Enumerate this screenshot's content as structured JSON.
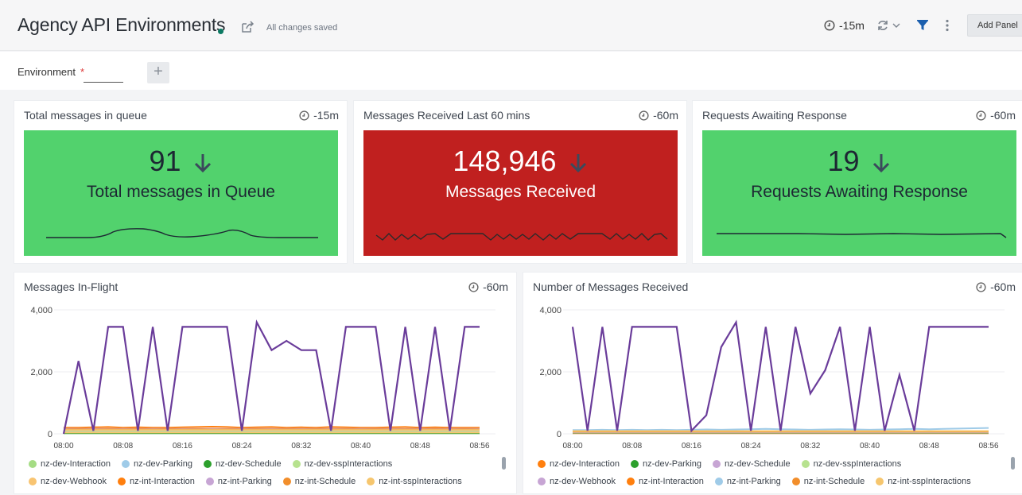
{
  "header": {
    "title": "Agency API Environments",
    "saved_status": "All changes saved",
    "time_range": "-15m",
    "add_panel_label": "Add Panel"
  },
  "variables": {
    "environment_label": "Environment",
    "required_marker": "*",
    "environment_value": "",
    "add_symbol": "+"
  },
  "panels": [
    {
      "title": "Total messages in queue",
      "time": "-15m",
      "value": "91",
      "label": "Total messages in Queue",
      "color": "#52d26d"
    },
    {
      "title": "Messages Received Last  60 mins",
      "time": "-60m",
      "value": "148,946",
      "label": "Messages Received",
      "color": "#c0201f"
    },
    {
      "title": "Requests Awaiting Response",
      "time": "-60m",
      "value": "19",
      "label": "Requests Awaiting Response",
      "color": "#52d26d"
    }
  ],
  "charts": {
    "inflight": {
      "title": "Messages In-Flight",
      "time": "-60m"
    },
    "received": {
      "title": "Number of Messages Received",
      "time": "-60m"
    }
  },
  "chart_data": [
    {
      "type": "line",
      "title": "Messages In-Flight",
      "xlabel": "",
      "ylabel": "",
      "x": [
        "08:00",
        "08:02",
        "08:04",
        "08:06",
        "08:08",
        "08:10",
        "08:12",
        "08:14",
        "08:16",
        "08:18",
        "08:20",
        "08:22",
        "08:24",
        "08:26",
        "08:28",
        "08:30",
        "08:32",
        "08:34",
        "08:36",
        "08:38",
        "08:40",
        "08:42",
        "08:44",
        "08:46",
        "08:48",
        "08:50",
        "08:52",
        "08:54",
        "08:56"
      ],
      "x_ticks": [
        "08:00",
        "08:08",
        "08:16",
        "08:24",
        "08:32",
        "08:40",
        "08:48",
        "08:56"
      ],
      "y_ticks": [
        "0",
        "2,000",
        "4,000"
      ],
      "ylim": [
        0,
        4000
      ],
      "grid": true,
      "legend": "bottom",
      "series": [
        {
          "name": "nz-dev-Interaction",
          "color": "#a5dc84",
          "values": [
            100,
            100,
            100,
            100,
            100,
            100,
            100,
            100,
            100,
            100,
            100,
            100,
            100,
            100,
            100,
            100,
            100,
            100,
            100,
            100,
            100,
            100,
            100,
            100,
            100,
            100,
            100,
            100,
            100
          ]
        },
        {
          "name": "nz-dev-Parking",
          "color": "#9fcbe8",
          "values": [
            80,
            80,
            80,
            80,
            80,
            80,
            80,
            80,
            80,
            80,
            80,
            80,
            80,
            80,
            80,
            80,
            80,
            80,
            80,
            80,
            80,
            80,
            80,
            80,
            80,
            80,
            80,
            80,
            80
          ]
        },
        {
          "name": "nz-dev-Schedule",
          "color": "#2ca02c",
          "values": [
            20,
            20,
            20,
            20,
            20,
            20,
            20,
            20,
            20,
            20,
            20,
            20,
            20,
            20,
            20,
            20,
            20,
            20,
            20,
            20,
            20,
            20,
            20,
            20,
            20,
            20,
            20,
            20,
            20
          ]
        },
        {
          "name": "nz-dev-sspInteractions",
          "color": "#b7e28f",
          "values": [
            60,
            60,
            60,
            60,
            60,
            60,
            60,
            60,
            60,
            60,
            60,
            60,
            60,
            60,
            60,
            60,
            60,
            60,
            60,
            60,
            60,
            60,
            60,
            60,
            60,
            60,
            60,
            60,
            60
          ]
        },
        {
          "name": "nz-dev-Webhook",
          "color": "#f8c471",
          "values": [
            40,
            40,
            40,
            40,
            40,
            40,
            40,
            40,
            40,
            40,
            40,
            40,
            40,
            40,
            40,
            40,
            40,
            40,
            40,
            40,
            40,
            40,
            40,
            40,
            40,
            40,
            40,
            40,
            40
          ]
        },
        {
          "name": "nz-int-Interaction",
          "color": "#ff7f0e",
          "values": [
            200,
            200,
            210,
            220,
            200,
            210,
            200,
            200,
            210,
            220,
            230,
            220,
            200,
            210,
            220,
            200,
            210,
            200,
            220,
            210,
            200,
            200,
            210,
            220,
            200,
            210,
            200,
            200,
            200
          ]
        },
        {
          "name": "nz-int-Parking",
          "color": "#c7a5d4",
          "values": [
            160,
            160,
            160,
            160,
            160,
            160,
            160,
            160,
            160,
            160,
            160,
            160,
            160,
            160,
            160,
            160,
            160,
            160,
            160,
            160,
            160,
            160,
            160,
            160,
            160,
            160,
            160,
            160,
            160
          ]
        },
        {
          "name": "nz-int-Schedule",
          "color": "#f28e2b",
          "values": [
            140,
            150,
            140,
            150,
            140,
            150,
            140,
            150,
            140,
            150,
            140,
            150,
            140,
            150,
            140,
            150,
            140,
            150,
            140,
            150,
            140,
            150,
            140,
            150,
            140,
            150,
            140,
            150,
            140
          ]
        },
        {
          "name": "nz-int-sspInteractions",
          "color": "#f6c66e",
          "values": [
            120,
            120,
            120,
            120,
            120,
            120,
            120,
            120,
            120,
            120,
            120,
            120,
            120,
            120,
            120,
            120,
            120,
            120,
            120,
            120,
            120,
            120,
            120,
            120,
            120,
            120,
            120,
            120,
            120
          ]
        },
        {
          "name": "",
          "color": "#6a3c9a",
          "values": [
            0,
            2350,
            100,
            3450,
            3450,
            100,
            3450,
            100,
            3450,
            3450,
            3450,
            3450,
            100,
            3600,
            2700,
            3000,
            2700,
            2700,
            100,
            3450,
            3450,
            3450,
            100,
            3450,
            100,
            3450,
            100,
            3450,
            3450
          ]
        }
      ]
    },
    {
      "type": "line",
      "title": "Number of Messages Received",
      "xlabel": "",
      "ylabel": "",
      "x": [
        "08:00",
        "08:02",
        "08:04",
        "08:06",
        "08:08",
        "08:10",
        "08:12",
        "08:14",
        "08:16",
        "08:18",
        "08:20",
        "08:22",
        "08:24",
        "08:26",
        "08:28",
        "08:30",
        "08:32",
        "08:34",
        "08:36",
        "08:38",
        "08:40",
        "08:42",
        "08:44",
        "08:46",
        "08:48",
        "08:50",
        "08:52",
        "08:54",
        "08:56"
      ],
      "x_ticks": [
        "08:00",
        "08:08",
        "08:16",
        "08:24",
        "08:32",
        "08:40",
        "08:48",
        "08:56"
      ],
      "y_ticks": [
        "0",
        "2,000",
        "4,000"
      ],
      "ylim": [
        0,
        4000
      ],
      "grid": true,
      "legend": "bottom",
      "series": [
        {
          "name": "nz-dev-Interaction",
          "color": "#ff7f0e",
          "values": [
            20,
            20,
            20,
            20,
            20,
            20,
            20,
            20,
            20,
            20,
            20,
            20,
            20,
            20,
            20,
            20,
            20,
            20,
            20,
            20,
            20,
            20,
            20,
            20,
            20,
            20,
            20,
            20,
            20
          ]
        },
        {
          "name": "nz-dev-Parking",
          "color": "#2ca02c",
          "values": [
            30,
            30,
            30,
            30,
            30,
            30,
            30,
            30,
            30,
            30,
            30,
            30,
            30,
            30,
            30,
            30,
            30,
            30,
            30,
            30,
            30,
            30,
            30,
            30,
            30,
            30,
            30,
            30,
            30
          ]
        },
        {
          "name": "nz-dev-Schedule",
          "color": "#c7a5d4",
          "values": [
            40,
            40,
            40,
            40,
            40,
            40,
            40,
            40,
            40,
            40,
            40,
            40,
            40,
            40,
            40,
            40,
            40,
            40,
            40,
            40,
            40,
            40,
            40,
            40,
            40,
            40,
            40,
            40,
            40
          ]
        },
        {
          "name": "nz-dev-sspInteractions",
          "color": "#b7e28f",
          "values": [
            50,
            50,
            50,
            50,
            50,
            50,
            50,
            50,
            50,
            50,
            50,
            50,
            50,
            50,
            50,
            50,
            50,
            50,
            50,
            50,
            50,
            50,
            50,
            50,
            50,
            50,
            50,
            50,
            50
          ]
        },
        {
          "name": "nz-dev-Webhook",
          "color": "#c7a5d4",
          "values": [
            60,
            60,
            60,
            60,
            60,
            60,
            60,
            60,
            60,
            60,
            60,
            60,
            60,
            60,
            60,
            60,
            60,
            60,
            60,
            60,
            60,
            60,
            60,
            60,
            60,
            60,
            60,
            60,
            60
          ]
        },
        {
          "name": "nz-int-Interaction",
          "color": "#ff7f0e",
          "values": [
            80,
            80,
            80,
            80,
            80,
            80,
            80,
            80,
            80,
            80,
            80,
            80,
            80,
            80,
            80,
            80,
            80,
            80,
            80,
            80,
            80,
            80,
            80,
            80,
            80,
            80,
            80,
            80,
            80
          ]
        },
        {
          "name": "nz-int-Parking",
          "color": "#9fcbe8",
          "values": [
            120,
            120,
            130,
            120,
            130,
            120,
            130,
            120,
            130,
            140,
            130,
            140,
            150,
            160,
            150,
            140,
            130,
            140,
            150,
            140,
            130,
            140,
            150,
            160,
            150,
            160,
            170,
            180,
            190
          ]
        },
        {
          "name": "nz-int-Schedule",
          "color": "#f28e2b",
          "values": [
            70,
            70,
            70,
            70,
            70,
            70,
            70,
            70,
            70,
            70,
            70,
            70,
            70,
            70,
            70,
            70,
            70,
            70,
            70,
            70,
            70,
            70,
            70,
            70,
            70,
            70,
            70,
            70,
            70
          ]
        },
        {
          "name": "nz-int-sspInteractions",
          "color": "#f6c66e",
          "values": [
            90,
            90,
            90,
            90,
            90,
            90,
            90,
            90,
            90,
            90,
            90,
            90,
            90,
            90,
            90,
            90,
            90,
            90,
            90,
            90,
            90,
            90,
            90,
            90,
            90,
            90,
            90,
            90,
            90
          ]
        },
        {
          "name": "",
          "color": "#6a3c9a",
          "values": [
            3450,
            100,
            3450,
            100,
            3450,
            3450,
            3450,
            3450,
            100,
            600,
            2800,
            3600,
            100,
            3450,
            100,
            3450,
            1300,
            2050,
            3450,
            100,
            3450,
            100,
            1900,
            100,
            3450,
            3450,
            3450,
            3450,
            3450
          ]
        }
      ]
    }
  ]
}
